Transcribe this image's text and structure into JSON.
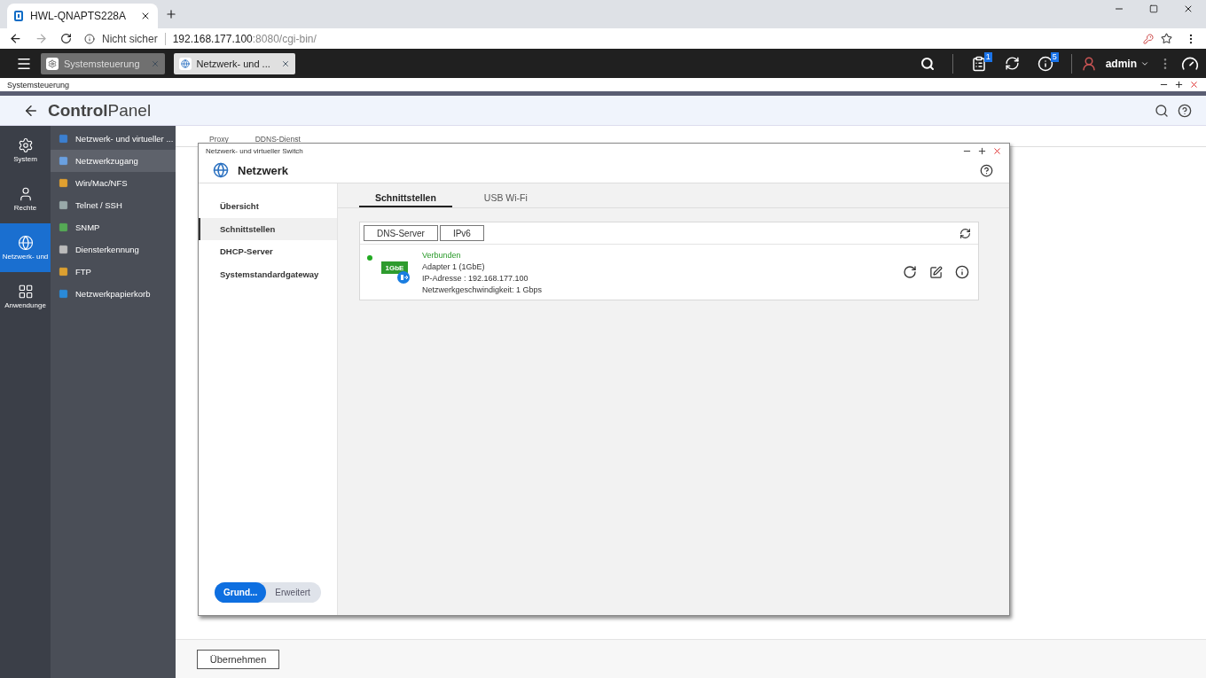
{
  "browser": {
    "tab_title": "HWL-QNAPTS228A",
    "security": "Nicht sicher",
    "url_host": "192.168.177.100",
    "url_rest": ":8080/cgi-bin/"
  },
  "app_tabs": [
    {
      "label": "Systemsteuerung",
      "selected": false
    },
    {
      "label": "Netzwerk- und ...",
      "selected": true
    }
  ],
  "topbar": {
    "task_badge": "1",
    "info_badge": "5",
    "user": "admin"
  },
  "window_strip": {
    "title": "Systemsteuerung"
  },
  "header": {
    "title_bold": "Control",
    "title_light": "Panel"
  },
  "rail": [
    {
      "label": "System",
      "selected": false
    },
    {
      "label": "Rechte",
      "selected": false
    },
    {
      "label": "Netzwerk- und",
      "selected": true
    },
    {
      "label": "Anwendunge",
      "selected": false
    }
  ],
  "menu": [
    {
      "label": "Netzwerk- und virtueller ...",
      "selected": false
    },
    {
      "label": "Netzwerkzugang",
      "selected": true
    },
    {
      "label": "Win/Mac/NFS",
      "selected": false
    },
    {
      "label": "Telnet / SSH",
      "selected": false
    },
    {
      "label": "SNMP",
      "selected": false
    },
    {
      "label": "Diensterkennung",
      "selected": false
    },
    {
      "label": "FTP",
      "selected": false
    },
    {
      "label": "Netzwerkpapierkorb",
      "selected": false
    }
  ],
  "page_tabs": [
    "Proxy",
    "DDNS-Dienst"
  ],
  "dialog": {
    "window_title": "Netzwerk- und virtueller Switch",
    "title": "Netzwerk",
    "nav": [
      {
        "label": "Übersicht",
        "selected": false
      },
      {
        "label": "Schnittstellen",
        "selected": true
      },
      {
        "label": "DHCP-Server",
        "selected": false
      },
      {
        "label": "Systemstandardgateway",
        "selected": false
      }
    ],
    "sub_tabs": [
      {
        "label": "Schnittstellen",
        "selected": true
      },
      {
        "label": "USB Wi-Fi",
        "selected": false
      }
    ],
    "toolbar_buttons": [
      "DNS-Server",
      "IPv6"
    ],
    "adapter": {
      "connected": true,
      "status": "Verbunden",
      "chip": "1GbE",
      "adapter_label": "Adapter",
      "adapter_value": "1 (1GbE)",
      "ip_label": "IP-Adresse :",
      "ip_value": "192.168.177.100",
      "speed_label": "Netzwerkgeschwindigkeit:",
      "speed_value": "1 Gbps"
    },
    "mode": [
      {
        "label": "Grund...",
        "selected": true
      },
      {
        "label": "Erweitert",
        "selected": false
      }
    ]
  },
  "apply_button": "Übernehmen"
}
